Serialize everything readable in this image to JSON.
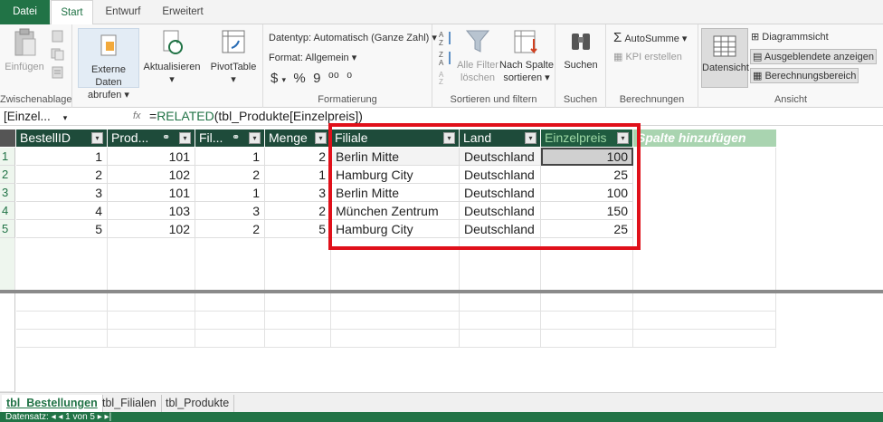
{
  "ribbon_tabs": {
    "datei": "Datei",
    "start": "Start",
    "entwurf": "Entwurf",
    "erweitert": "Erweitert"
  },
  "ribbon": {
    "zwischenablage": {
      "label": "Zwischenablage",
      "einfuegen": "Einfügen"
    },
    "externe": {
      "line1": "Externe Daten",
      "line2": "abrufen"
    },
    "aktualisieren": "Aktualisieren",
    "pivottable": "PivotTable",
    "formatierung": {
      "label": "Formatierung",
      "datentyp": "Datentyp: Automatisch (Ganze Zahl)",
      "format": "Format: Allgemein",
      "currency": "$",
      "percent": "%",
      "thousands": "9",
      "inc_dec": "⁰⁰",
      "dec_dec": "⁰"
    },
    "sortieren": {
      "label": "Sortieren und filtern",
      "alle_filter_1": "Alle Filter",
      "alle_filter_2": "löschen",
      "nach_spalte_1": "Nach Spalte",
      "nach_spalte_2": "sortieren"
    },
    "suchen": {
      "label": "Suchen",
      "button": "Suchen"
    },
    "berechnungen": {
      "label": "Berechnungen",
      "autosumme": "AutoSumme",
      "kpi": "KPI erstellen"
    },
    "ansicht": {
      "label": "Ansicht",
      "datensicht": "Datensicht",
      "diagrammsicht": "Diagrammsicht",
      "ausgeblendete": "Ausgeblendete anzeigen",
      "berechnungsbereich": "Berechnungsbereich"
    }
  },
  "formula_bar": {
    "name_box": "[Einzel...",
    "fx": "fx",
    "formula_prefix": "=",
    "formula_fn": "RELATED",
    "formula_rest": "(tbl_Produkte[Einzelpreis])"
  },
  "table": {
    "columns": [
      "BestellID",
      "Prod...",
      "Fil...",
      "Menge",
      "Filiale",
      "Land",
      "Einzelpreis",
      "Spalte hinzufügen"
    ],
    "rows": [
      {
        "n": "1",
        "bestellid": "1",
        "prod": "101",
        "fil": "1",
        "menge": "2",
        "filiale": "Berlin Mitte",
        "land": "Deutschland",
        "preis": "100"
      },
      {
        "n": "2",
        "bestellid": "2",
        "prod": "102",
        "fil": "2",
        "menge": "1",
        "filiale": "Hamburg City",
        "land": "Deutschland",
        "preis": "25"
      },
      {
        "n": "3",
        "bestellid": "3",
        "prod": "101",
        "fil": "1",
        "menge": "3",
        "filiale": "Berlin Mitte",
        "land": "Deutschland",
        "preis": "100"
      },
      {
        "n": "4",
        "bestellid": "4",
        "prod": "103",
        "fil": "3",
        "menge": "2",
        "filiale": "München Zentrum",
        "land": "Deutschland",
        "preis": "150"
      },
      {
        "n": "5",
        "bestellid": "5",
        "prod": "102",
        "fil": "2",
        "menge": "5",
        "filiale": "Hamburg City",
        "land": "Deutschland",
        "preis": "25"
      }
    ]
  },
  "sheet_tabs": [
    "tbl_Bestellungen",
    "tbl_Filialen",
    "tbl_Produkte"
  ],
  "status": "Datensatz:  ◂  ◂      1 von 5      ▸  ▸|",
  "colors": {
    "accent": "#217346",
    "highlight_box": "#e0101a",
    "header_dark": "#1e4b3a",
    "add_column": "#a9d4b0"
  }
}
